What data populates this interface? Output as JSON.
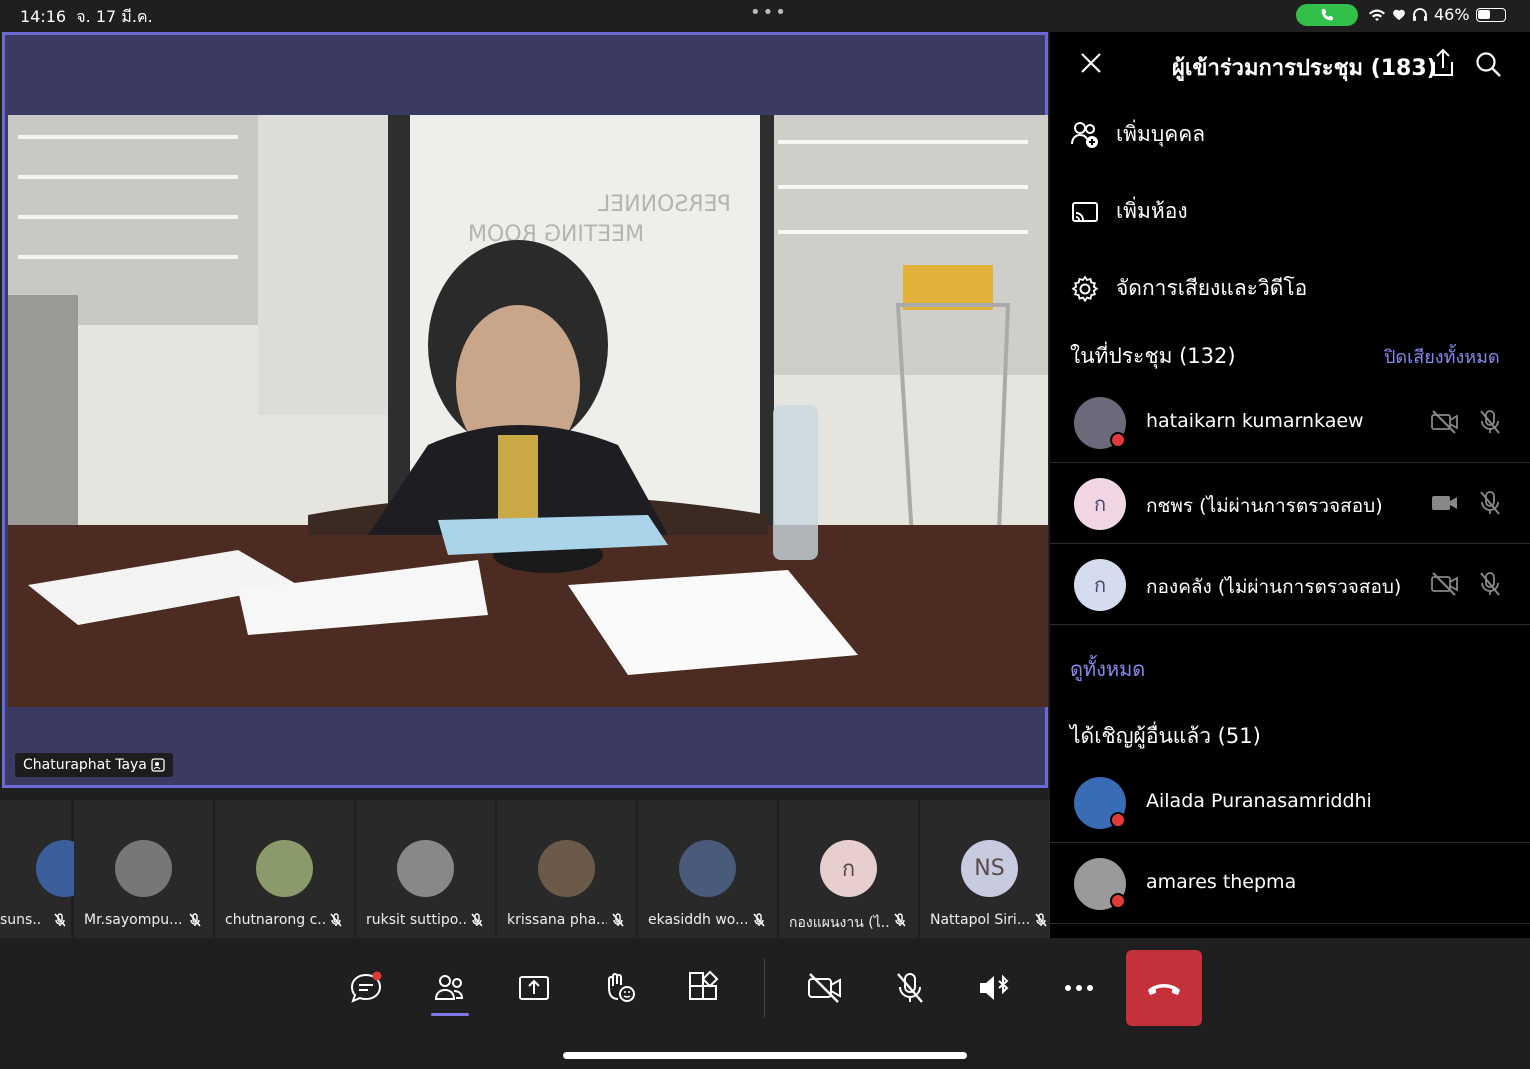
{
  "status": {
    "time": "14:16",
    "date": "จ. 17 มี.ค.",
    "battery_pct": "46%",
    "battery_level": 0.46,
    "icons": [
      "phone-icon",
      "wifi-icon",
      "heart-icon",
      "headphones-icon",
      "battery-icon"
    ]
  },
  "stage": {
    "speaker_name": "Chaturaphat Taya",
    "wall_text_1": "PERSONNEL",
    "wall_text_2": "MEETING ROOM"
  },
  "strip": [
    {
      "name": "suns...",
      "initials": "",
      "color": "#3a5f9a"
    },
    {
      "name": "Mr.sayompu...",
      "initials": "",
      "color": "#777"
    },
    {
      "name": "chutnarong c...",
      "initials": "",
      "color": "#8a9a6a"
    },
    {
      "name": "ruksit suttipo...",
      "initials": "",
      "color": "#888"
    },
    {
      "name": "krissana pha...",
      "initials": "",
      "color": "#6b5a4a"
    },
    {
      "name": "ekasiddh wo...",
      "initials": "",
      "color": "#4a5a7a"
    },
    {
      "name": "กองแผนงาน (ไ...",
      "initials": "ก",
      "color": "#e8cfcf"
    },
    {
      "name": "Nattapol Siri...",
      "initials": "NS",
      "color": "#c8cbe0"
    }
  ],
  "panel": {
    "title": "ผู้เข้าร่วมการประชุม (183)",
    "actions": {
      "add_person": "เพิ่มบุคคล",
      "add_room": "เพิ่มห้อง",
      "manage_av": "จัดการเสียงและวิดีโอ"
    },
    "in_meeting_label": "ในที่ประชุม (132)",
    "mute_all": "ปิดเสียงทั้งหมด",
    "in_meeting": [
      {
        "name": "hataikarn kumarnkaew",
        "initials": "",
        "color": "#6a6a7a",
        "video_icon": "video-off-icon",
        "mic_icon": "mic-off-icon"
      },
      {
        "name": "กชพร (ไม่ผ่านการตรวจสอบ)",
        "initials": "ก",
        "color": "#f1d7e4",
        "video_icon": "video-on-icon",
        "mic_icon": "mic-off-icon"
      },
      {
        "name": "กองคลัง (ไม่ผ่านการตรวจสอบ)",
        "initials": "ก",
        "color": "#d5dcf0",
        "video_icon": "video-off-icon",
        "mic_icon": "mic-off-icon"
      }
    ],
    "view_all": "ดูทั้งหมด",
    "invited_label": "ได้เชิญผู้อื่นแล้ว (51)",
    "invited": [
      {
        "name": "Ailada Puranasamriddhi",
        "initials": "",
        "color": "#3a6bb5"
      },
      {
        "name": "amares thepma",
        "initials": "",
        "color": "#9a9a9a"
      }
    ]
  },
  "toolbar": {
    "buttons": [
      "chat-icon",
      "people-icon",
      "share-icon",
      "raise-hand-icon",
      "apps-icon",
      "video-off-icon",
      "mic-off-icon",
      "speaker-bluetooth-icon",
      "more-icon"
    ],
    "active": "people-icon"
  }
}
